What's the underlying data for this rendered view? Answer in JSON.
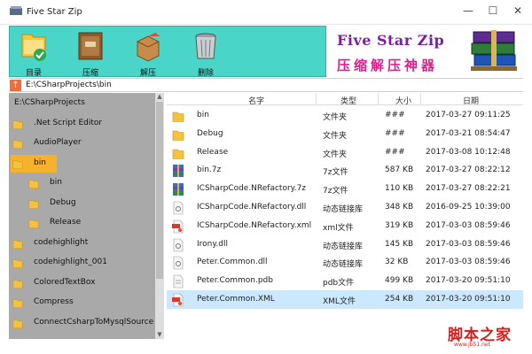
{
  "window": {
    "title": "Five Star Zip",
    "minimize_glyph": "—",
    "maximize_glyph": "☐",
    "close_glyph": "✕"
  },
  "toolbar": {
    "items": [
      {
        "label": "目录",
        "icon": "folder-check-icon"
      },
      {
        "label": "压缩",
        "icon": "archive-book-icon"
      },
      {
        "label": "解压",
        "icon": "open-box-icon"
      },
      {
        "label": "删除",
        "icon": "trash-can-icon"
      }
    ]
  },
  "banner": {
    "title": "Five Star Zip",
    "subtitle": "压缩解压神器"
  },
  "pathbar": {
    "up_glyph": "↑",
    "path": "E:\\CSharpProjects\\bin"
  },
  "tree": {
    "items": [
      {
        "label": "E:\\CSharpProjects",
        "level": 0,
        "icon": false,
        "selected": false
      },
      {
        "label": ".Net Script Editor",
        "level": 0,
        "icon": true,
        "selected": false
      },
      {
        "label": "AudioPlayer",
        "level": 0,
        "icon": true,
        "selected": false
      },
      {
        "label": "bin",
        "level": 0,
        "icon": true,
        "selected": true
      },
      {
        "label": "bin",
        "level": 1,
        "icon": true,
        "selected": false
      },
      {
        "label": "Debug",
        "level": 1,
        "icon": true,
        "selected": false
      },
      {
        "label": "Release",
        "level": 1,
        "icon": true,
        "selected": false
      },
      {
        "label": "codehighlight",
        "level": 0,
        "icon": true,
        "selected": false
      },
      {
        "label": "codehighlight_001",
        "level": 0,
        "icon": true,
        "selected": false
      },
      {
        "label": "ColoredTextBox",
        "level": 0,
        "icon": true,
        "selected": false
      },
      {
        "label": "Compress",
        "level": 0,
        "icon": true,
        "selected": false
      },
      {
        "label": "ConnectCsharpToMysqlSource",
        "level": 0,
        "icon": true,
        "selected": false
      }
    ]
  },
  "filelist": {
    "columns": [
      "名字",
      "类型",
      "大小",
      "日期"
    ],
    "rows": [
      {
        "name": "bin",
        "type": "文件夹",
        "size": "###",
        "date": "2017-03-27 09:11:25",
        "icon": "folder-icon",
        "selected": false
      },
      {
        "name": "Debug",
        "type": "文件夹",
        "size": "###",
        "date": "2017-03-21 08:54:47",
        "icon": "folder-icon",
        "selected": false
      },
      {
        "name": "Release",
        "type": "文件夹",
        "size": "###",
        "date": "2017-03-08 10:12:48",
        "icon": "folder-icon",
        "selected": false
      },
      {
        "name": "bin.7z",
        "type": "7z文件",
        "size": "587 KB",
        "date": "2017-03-27 08:22:12",
        "icon": "archive-icon",
        "selected": false
      },
      {
        "name": "ICSharpCode.NRefactory.7z",
        "type": "7z文件",
        "size": "110 KB",
        "date": "2017-03-27 08:22:21",
        "icon": "archive-icon",
        "selected": false
      },
      {
        "name": "ICSharpCode.NRefactory.dll",
        "type": "动态链接库",
        "size": "348 KB",
        "date": "2016-09-25 10:39:00",
        "icon": "dll-icon",
        "selected": false
      },
      {
        "name": "ICSharpCode.NRefactory.xml",
        "type": "xml文件",
        "size": "319 KB",
        "date": "2017-03-03 08:59:46",
        "icon": "xml-icon",
        "selected": false
      },
      {
        "name": "Irony.dll",
        "type": "动态链接库",
        "size": "145 KB",
        "date": "2017-03-03 08:59:46",
        "icon": "dll-icon",
        "selected": false
      },
      {
        "name": "Peter.Common.dll",
        "type": "动态链接库",
        "size": "32 KB",
        "date": "2017-03-03 08:59:46",
        "icon": "dll-icon",
        "selected": false
      },
      {
        "name": "Peter.Common.pdb",
        "type": "pdb文件",
        "size": "499 KB",
        "date": "2017-03-20 09:51:10",
        "icon": "file-icon",
        "selected": false
      },
      {
        "name": "Peter.Common.XML",
        "type": "XML文件",
        "size": "254 KB",
        "date": "2017-03-20 09:51:10",
        "icon": "xml-icon",
        "selected": true
      }
    ]
  },
  "watermark": {
    "text": "脚本之家",
    "sub": "www.jb51.net"
  }
}
